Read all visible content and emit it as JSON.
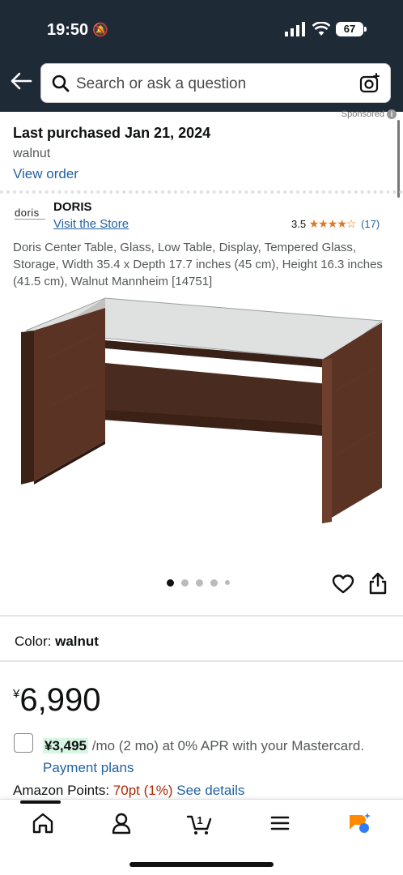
{
  "status_bar": {
    "time": "19:50",
    "battery": "67"
  },
  "search": {
    "placeholder": "Search or ask a question"
  },
  "sponsored_label": "Sponsored",
  "last_purchased": {
    "title": "Last purchased Jan 21, 2024",
    "variant": "walnut",
    "link": "View order"
  },
  "brand": {
    "logo_text": "doris",
    "name": "DORIS",
    "store_link": "Visit the Store"
  },
  "rating": {
    "value": "3.5",
    "stars": 3.5,
    "count": "(17)"
  },
  "product": {
    "title": "Doris Center Table, Glass, Low Table, Display, Tempered Glass, Storage, Width 35.4 x Depth 17.7 inches (45 cm), Height 16.3 inches (41.5 cm), Walnut Mannheim [14751]"
  },
  "carousel": {
    "total": 5,
    "active": 1
  },
  "color": {
    "label": "Color:",
    "value": "walnut"
  },
  "price": {
    "currency": "¥",
    "amount": "6,990"
  },
  "installment": {
    "amount": "¥3,495",
    "text": " /mo (2 mo) at 0% APR with your Mastercard.",
    "link": "Payment plans"
  },
  "points": {
    "label": "Amazon Points:",
    "value": "70pt",
    "percent": "(1%)",
    "link": "See details"
  },
  "bottom_nav": {
    "items": [
      "home-icon",
      "account-icon",
      "cart-icon",
      "menu-icon",
      "rufus-icon"
    ],
    "cart_count": "1"
  },
  "colors": {
    "header_bg": "#1f2a37",
    "link": "#2162a1",
    "star": "#de7921",
    "red": "#b12704"
  }
}
